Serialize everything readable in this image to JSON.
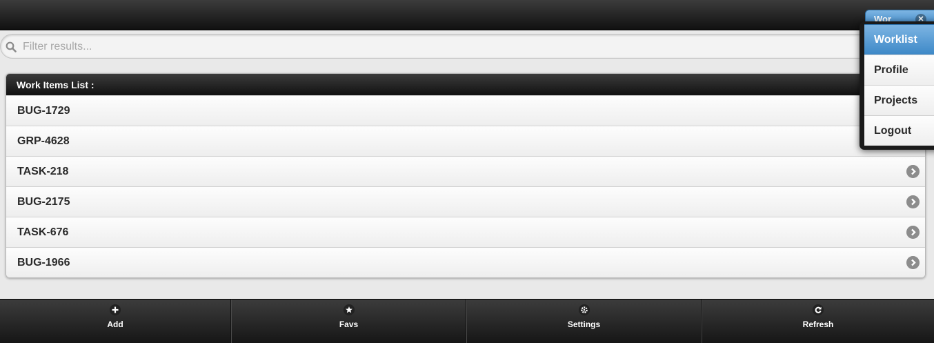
{
  "header": {
    "button_label": "Wor",
    "button_icon": "close-icon"
  },
  "search": {
    "placeholder": "Filter results...",
    "value": "",
    "icon": "search-icon"
  },
  "list": {
    "divider": "Work Items List :",
    "items": [
      {
        "label": "BUG-1729"
      },
      {
        "label": "GRP-4628"
      },
      {
        "label": "TASK-218"
      },
      {
        "label": "BUG-2175"
      },
      {
        "label": "TASK-676"
      },
      {
        "label": "BUG-1966"
      }
    ],
    "item_icon": "arrow-right-icon"
  },
  "menu": {
    "items": [
      {
        "label": "Worklist",
        "active": true
      },
      {
        "label": "Profile",
        "active": false
      },
      {
        "label": "Projects",
        "active": false
      },
      {
        "label": "Logout",
        "active": false
      }
    ]
  },
  "navbar": {
    "items": [
      {
        "label": "Add",
        "icon": "plus-icon"
      },
      {
        "label": "Favs",
        "icon": "star-icon"
      },
      {
        "label": "Settings",
        "icon": "gear-icon"
      },
      {
        "label": "Refresh",
        "icon": "refresh-icon"
      }
    ]
  },
  "colors": {
    "bar_dark": "#111111",
    "active_blue": "#3d88c7",
    "page_bg": "#e9e9e9"
  }
}
